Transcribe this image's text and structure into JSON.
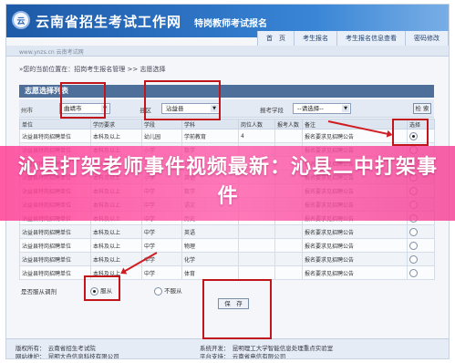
{
  "header": {
    "logo_text": "云",
    "site_title": "云南省招生考试工作网",
    "sub_title": "特岗教师考试报名",
    "nav": [
      "首　页",
      "考生报名",
      "考生报名信息查看",
      "密码修改"
    ]
  },
  "strip_text": "www.ynzs.cn 云南考试网",
  "breadcrumb": "»您的当前位置在：招岗考生报名管理 >> 志愿选择",
  "panel": {
    "title": "志愿选择列表",
    "filters": {
      "city_label": "州市",
      "city_value": "曲靖市",
      "county_label": "县区",
      "county_value": "沾益县",
      "subject_label": "报考学段",
      "subject_value": "--请选择--",
      "query_button": "检 索"
    }
  },
  "table": {
    "columns": [
      "单位",
      "学历要求",
      "学段",
      "学科",
      "岗位人数",
      "报考人数",
      "备注",
      "选择"
    ],
    "rows": [
      [
        "沾益县特岗招聘单位",
        "本科及以上",
        "幼儿园",
        "学前教育",
        "4",
        "",
        "报名要求见招聘公告"
      ],
      [
        "沾益县特岗招聘单位",
        "本科及以上",
        "小学",
        "数学",
        "",
        "",
        "报名要求见招聘公告"
      ],
      [
        "沾益县特岗招聘单位",
        "本科及以上",
        "小学",
        "语文",
        "",
        "",
        "报名要求见招聘公告"
      ],
      [
        "沾益县特岗招聘单位",
        "本科及以上",
        "小学",
        "英语",
        "",
        "",
        "报名要求见招聘公告"
      ],
      [
        "沾益县特岗招聘单位",
        "本科及以上",
        "中学",
        "数学",
        "",
        "",
        "报名要求见招聘公告"
      ],
      [
        "沾益县特岗招聘单位",
        "本科及以上",
        "中学",
        "语文",
        "",
        "",
        "报名要求见招聘公告"
      ],
      [
        "沾益县特岗招聘单位",
        "本科及以上",
        "中学",
        "历史",
        "",
        "",
        "报名要求见招聘公告"
      ],
      [
        "沾益县特岗招聘单位",
        "本科及以上",
        "中学",
        "英语",
        "",
        "",
        "报名要求见招聘公告"
      ],
      [
        "沾益县特岗招聘单位",
        "本科及以上",
        "中学",
        "物理",
        "",
        "",
        "报名要求见招聘公告"
      ],
      [
        "沾益县特岗招聘单位",
        "本科及以上",
        "中学",
        "化学",
        "",
        "",
        "报名要求见招聘公告"
      ],
      [
        "沾益县特岗招聘单位",
        "本科及以上",
        "中学",
        "体育",
        "",
        "",
        "报名要求见招聘公告"
      ]
    ],
    "selected_row": 0
  },
  "dispatch": {
    "question": "是否服从调剂",
    "yes": "服从",
    "no": "不服从",
    "selected": "yes"
  },
  "save_button": "保　存",
  "footer": {
    "copyright": "版权所有：　云南省招生考试院",
    "maintainer": "网站维护：　昆明大舟信息科技有限公司",
    "support": "系统开发：　昆明理工大学智能信息处理重点实验室",
    "platform": "平台支持：　云南省电信有限公司"
  },
  "banner_text": "沁县打架老师事件视频最新：沁县二中打架事件",
  "colors": {
    "header_blue": "#2e74c5",
    "annotation_red": "#c0161b",
    "banner_pink": "#ff5aaa"
  }
}
